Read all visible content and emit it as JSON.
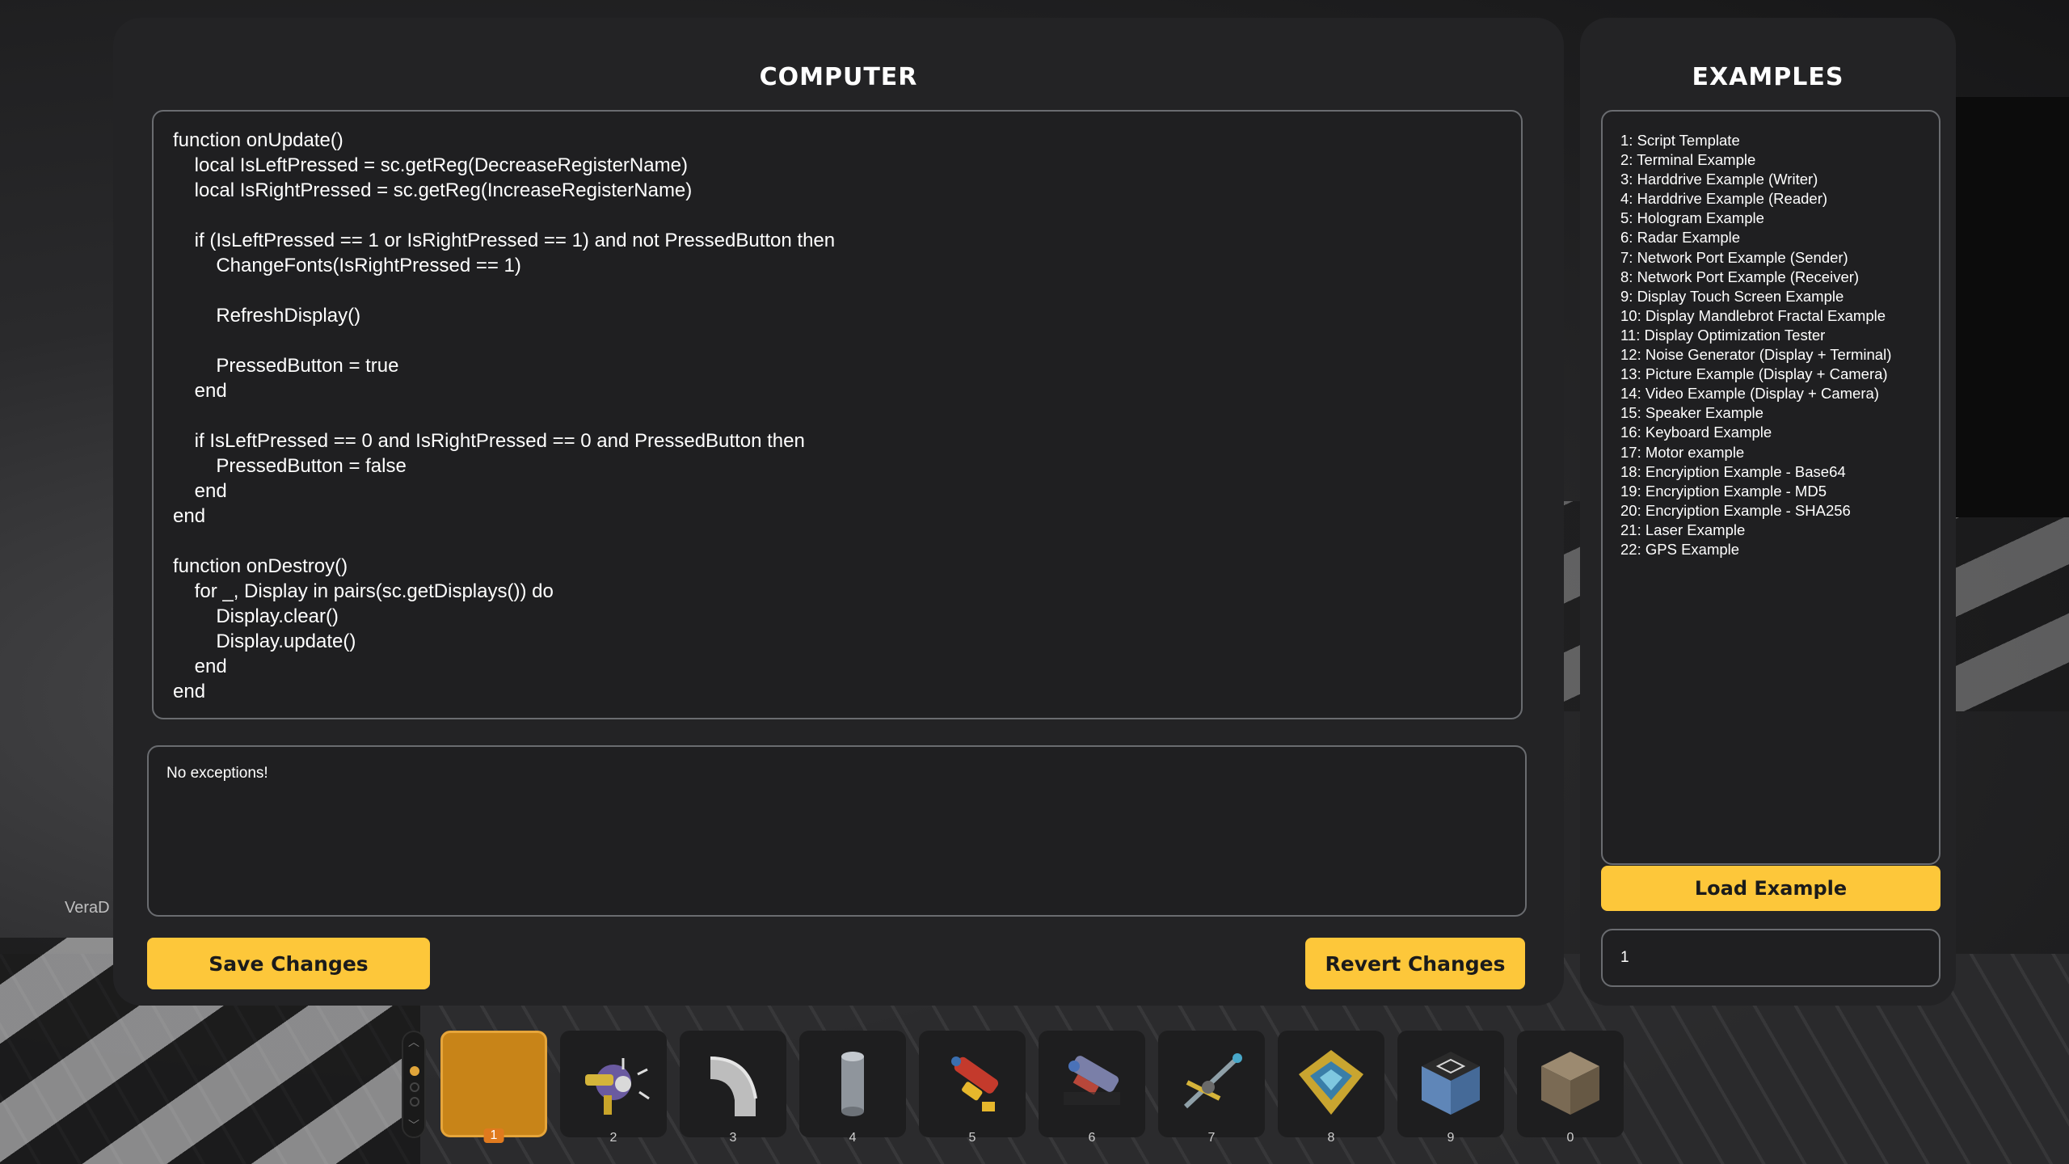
{
  "computer": {
    "title": "COMPUTER",
    "code": "function onUpdate()\n    local IsLeftPressed = sc.getReg(DecreaseRegisterName)\n    local IsRightPressed = sc.getReg(IncreaseRegisterName)\n\n    if (IsLeftPressed == 1 or IsRightPressed == 1) and not PressedButton then\n        ChangeFonts(IsRightPressed == 1)\n\n        RefreshDisplay()\n\n        PressedButton = true\n    end\n\n    if IsLeftPressed == 0 and IsRightPressed == 0 and PressedButton then\n        PressedButton = false\n    end\nend\n\nfunction onDestroy()\n    for _, Display in pairs(sc.getDisplays()) do\n        Display.clear()\n        Display.update()\n    end\nend",
    "log": "No exceptions!",
    "save_label": "Save Changes",
    "revert_label": "Revert Changes"
  },
  "examples": {
    "title": "EXAMPLES",
    "items": [
      "1: Script Template",
      "2: Terminal Example",
      "3: Harddrive Example (Writer)",
      "4: Harddrive Example (Reader)",
      "5: Hologram Example",
      "6: Radar Example",
      "7: Network Port Example (Sender)",
      "8: Network Port Example (Receiver)",
      "9: Display Touch Screen Example",
      "10: Display Mandlebrot Fractal Example",
      "11: Display Optimization Tester",
      "12: Noise Generator (Display + Terminal)",
      "13: Picture Example (Display + Camera)",
      "14: Video Example (Display + Camera)",
      "15: Speaker Example",
      "16: Keyboard Example",
      "17: Motor example",
      "18: Encryiption Example - Base64",
      "19: Encryiption Example - MD5",
      "20: Encryiption Example - SHA256",
      "21: Laser Example",
      "22: GPS Example"
    ],
    "load_label": "Load Example",
    "input_value": "1"
  },
  "overlay_text": "VeraD",
  "hotbar": {
    "selected_slot": "1",
    "slots": [
      {
        "num": "1",
        "icon": "empty-slot-icon"
      },
      {
        "num": "2",
        "icon": "spud-gun-icon"
      },
      {
        "num": "3",
        "icon": "pipe-bend-icon"
      },
      {
        "num": "4",
        "icon": "cylinder-block-icon"
      },
      {
        "num": "5",
        "icon": "tool-gun-icon"
      },
      {
        "num": "6",
        "icon": "gravity-gun-icon"
      },
      {
        "num": "7",
        "icon": "connect-tool-icon"
      },
      {
        "num": "8",
        "icon": "computer-chip-icon"
      },
      {
        "num": "9",
        "icon": "glass-block-icon"
      },
      {
        "num": "0",
        "icon": "wood-block-icon"
      }
    ]
  },
  "colors": {
    "accent": "#fdc73a",
    "panel": "#232325",
    "selected_slot": "#c88418"
  }
}
